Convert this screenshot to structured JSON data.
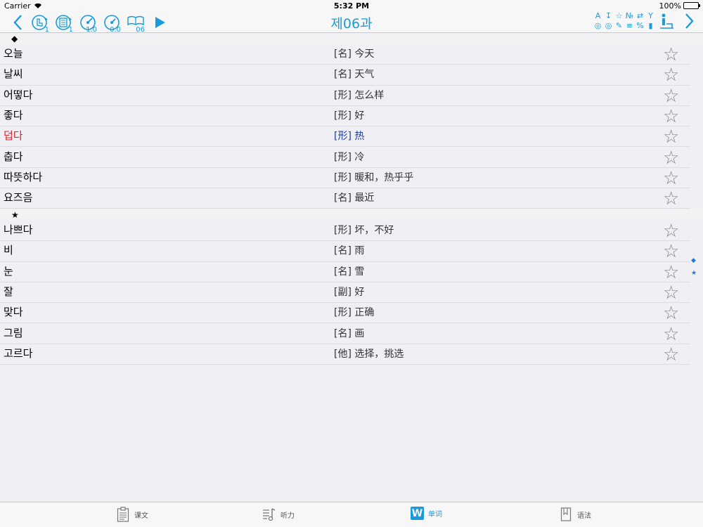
{
  "status": {
    "carrier": "Carrier",
    "time": "5:32 PM",
    "battery": "100%"
  },
  "nav": {
    "title": "제06과",
    "btn_sub_1": "1",
    "btn_sub_2": "1",
    "speed_1": "1.0",
    "speed_2": "0.0",
    "lesson_num": "06",
    "right_icons": [
      "A",
      "↧",
      "☆",
      "№",
      "⇄",
      "Y",
      "◎",
      "◎",
      "✎",
      "≡",
      "%",
      "▮"
    ]
  },
  "sections": [
    {
      "header": "◆",
      "items": [
        {
          "word": "오늘",
          "meaning": "[名] 今天",
          "star": "☆"
        },
        {
          "word": "날씨",
          "meaning": "[名] 天气",
          "star": "☆"
        },
        {
          "word": "어떻다",
          "meaning": "[形] 怎么样",
          "star": "☆"
        },
        {
          "word": "좋다",
          "meaning": "[形] 好",
          "star": "☆"
        },
        {
          "word": "덥다",
          "meaning": "[形] 热",
          "star": "☆"
        },
        {
          "word": "춥다",
          "meaning": "[形] 冷",
          "star": "☆"
        },
        {
          "word": "따뜻하다",
          "meaning": "[形] 暖和，热乎乎",
          "star": "☆"
        },
        {
          "word": "요즈음",
          "meaning": "[名] 最近",
          "star": "☆"
        }
      ]
    },
    {
      "header": "★",
      "items": [
        {
          "word": "나쁘다",
          "meaning": "[形] 坏，不好",
          "star": "☆"
        },
        {
          "word": "비",
          "meaning": "[名] 雨",
          "star": "☆"
        },
        {
          "word": "눈",
          "meaning": "[名] 雪",
          "star": "☆"
        },
        {
          "word": "잘",
          "meaning": "[副] 好",
          "star": "☆"
        },
        {
          "word": "맞다",
          "meaning": "[形] 正确",
          "star": "☆"
        },
        {
          "word": "그림",
          "meaning": "[名] 画",
          "star": "☆"
        },
        {
          "word": "고르다",
          "meaning": "[他] 选择，挑选",
          "star": "☆"
        }
      ]
    }
  ],
  "index": [
    "◆",
    "★"
  ],
  "tabs": [
    {
      "label": "课文",
      "icon": "📄"
    },
    {
      "label": "听力",
      "icon": "♫"
    },
    {
      "label": "单词",
      "icon": "W"
    },
    {
      "label": "语法",
      "icon": "🔖"
    }
  ],
  "colors": {
    "accent": "#1a9bdb",
    "highlight_word": "#e0212b",
    "highlight_meaning": "#1a3aa8"
  }
}
